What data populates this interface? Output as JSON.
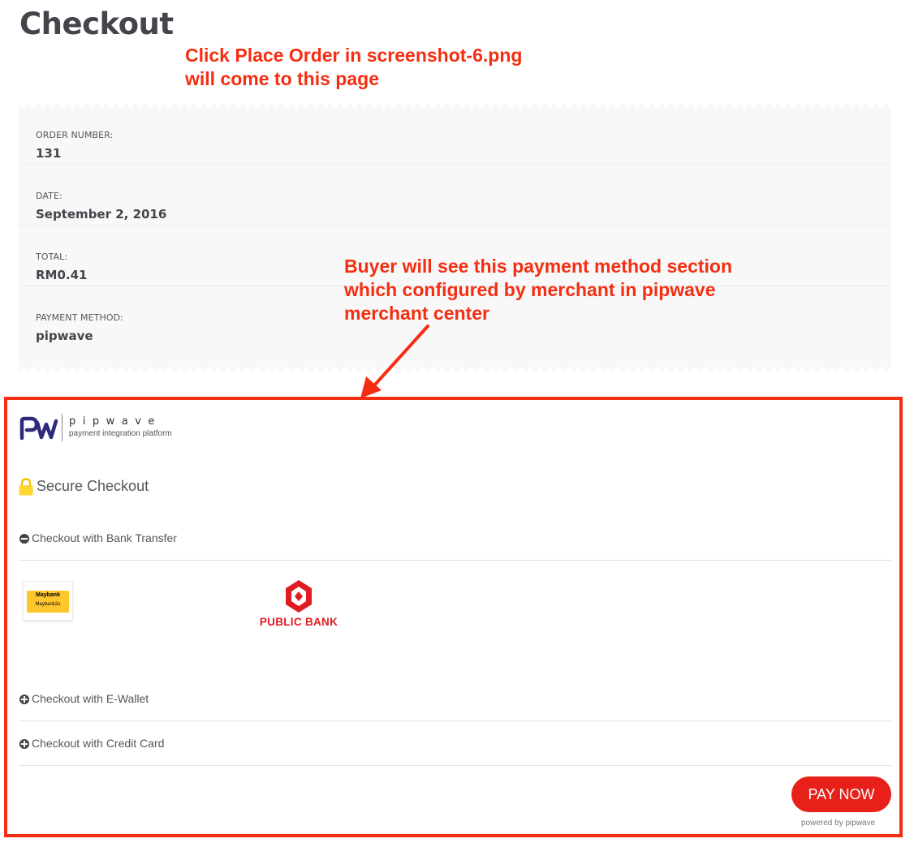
{
  "page": {
    "title": "Checkout"
  },
  "annotations": {
    "note_1_line_1": "Click Place Order in screenshot-6.png",
    "note_1_line_2": "will come to this page",
    "note_2_line_1": "Buyer will see this payment method section",
    "note_2_line_2": "which configured by merchant in pipwave",
    "note_2_line_3": "merchant center",
    "color": "#f42e12"
  },
  "order": {
    "number_label": "ORDER NUMBER:",
    "number_value": "131",
    "date_label": "DATE:",
    "date_value": "September 2, 2016",
    "total_label": "TOTAL:",
    "total_value": "RM0.41",
    "method_label": "PAYMENT METHOD:",
    "method_value": "pipwave"
  },
  "pipwave": {
    "brand_name": "pipwave",
    "tagline": "payment integration platform",
    "secure_label": "Secure Checkout",
    "brand_color": "#2d2a7a"
  },
  "payment_sections": {
    "bank_transfer": {
      "label": "Checkout with Bank Transfer",
      "state": "expanded",
      "icon": "minus-circle-icon"
    },
    "ewallet": {
      "label": "Checkout with E-Wallet",
      "state": "collapsed",
      "icon": "plus-circle-icon"
    },
    "credit_card": {
      "label": "Checkout with Credit Card",
      "state": "collapsed",
      "icon": "plus-circle-icon"
    }
  },
  "banks": {
    "maybank": {
      "title": "Maybank",
      "subtitle": "Maybank2u",
      "color": "#ffc72c"
    },
    "public_bank": {
      "name": "PUBLIC BANK",
      "color": "#e11b22"
    }
  },
  "pay_button": {
    "label": "PAY NOW",
    "color": "#e7211a"
  },
  "footer": {
    "powered_by": "powered by pipwave"
  }
}
